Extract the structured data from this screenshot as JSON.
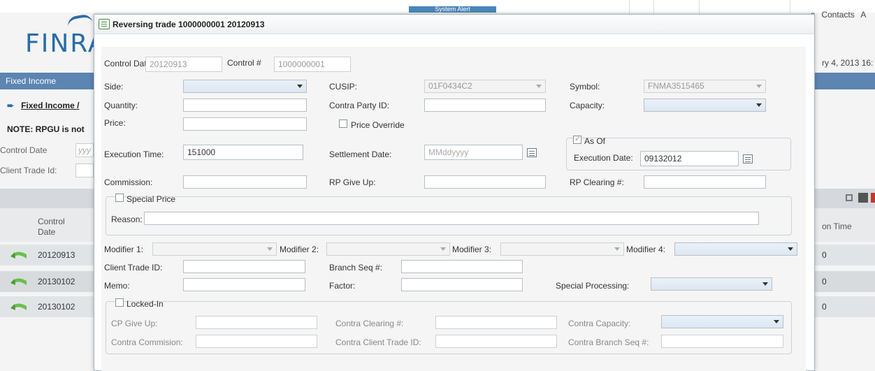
{
  "background": {
    "logo": "FINRA",
    "system_alert": "System Alert",
    "top_links": [
      "s",
      "Contacts",
      "A"
    ],
    "date_fragment": "ry 4, 2013 16:",
    "nav_title": "Fixed Income",
    "breadcrumb": "Fixed Income /",
    "note": "NOTE: RPGU is not",
    "control_date_label": "Control Date",
    "control_date_placeholder": "yyy",
    "client_trade_id_label": "Client Trade Id:",
    "grid_header": "Control Date",
    "grid_rows": [
      "20120913",
      "20130102",
      "20130102"
    ],
    "right_header": "on Time",
    "right_rows": [
      "0",
      "0",
      "0"
    ]
  },
  "dialog": {
    "title": "Reversing trade 1000000001 20120913",
    "control_date_label": "Control Dat",
    "control_date_value": "20120913",
    "control_num_label": "Control #",
    "control_num_value": "1000000001",
    "side_label": "Side:",
    "cusip_label": "CUSIP:",
    "cusip_value": "01F0434C2",
    "symbol_label": "Symbol:",
    "symbol_value": "FNMA3515465",
    "quantity_label": "Quantity:",
    "contra_party_label": "Contra Party ID:",
    "capacity_label": "Capacity:",
    "price_label": "Price:",
    "price_override_label": "Price Override",
    "as_of_label": "As Of",
    "execution_time_label": "Execution Time:",
    "execution_time_value": "151000",
    "settlement_date_label": "Settlement Date:",
    "settlement_date_placeholder": "MMddyyyy",
    "execution_date_label": "Execution Date:",
    "execution_date_value": "09132012",
    "commission_label": "Commission:",
    "rp_give_up_label": "RP Give Up:",
    "rp_clearing_label": "RP Clearing #:",
    "special_price_label": "Special Price",
    "reason_label": "Reason:",
    "modifier1_label": "Modifier 1:",
    "modifier2_label": "Modifier 2:",
    "modifier3_label": "Modifier 3:",
    "modifier4_label": "Modifier 4:",
    "client_trade_id_label": "Client Trade ID:",
    "branch_seq_label": "Branch Seq #:",
    "memo_label": "Memo:",
    "factor_label": "Factor:",
    "special_processing_label": "Special Processing:",
    "locked_in_label": "Locked-In",
    "cp_give_up_label": "CP Give Up:",
    "contra_clearing_label": "Contra Clearing #:",
    "contra_capacity_label": "Contra Capacity:",
    "contra_commission_label": "Contra Commision:",
    "contra_client_trade_id_label": "Contra Client Trade ID:",
    "contra_branch_seq_label": "Contra Branch Seq #:"
  }
}
